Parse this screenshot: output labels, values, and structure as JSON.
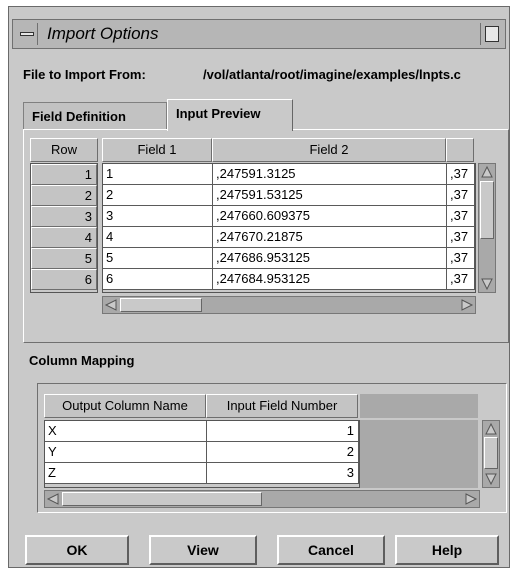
{
  "window": {
    "title": "Import Options"
  },
  "file": {
    "label": "File to Import From:",
    "path": "/vol/atlanta/root/imagine/examples/lnpts.c"
  },
  "tabs": [
    {
      "label": "Field Definition",
      "active": false
    },
    {
      "label": "Input Preview",
      "active": true
    }
  ],
  "preview": {
    "row_header": "Row",
    "columns": [
      "Field 1",
      "Field 2",
      ""
    ],
    "rows": [
      {
        "row": "1",
        "field1": "1",
        "field2": ",247591.3125",
        "field3": ",37"
      },
      {
        "row": "2",
        "field1": "2",
        "field2": ",247591.53125",
        "field3": ",37"
      },
      {
        "row": "3",
        "field1": "3",
        "field2": ",247660.609375",
        "field3": ",37"
      },
      {
        "row": "4",
        "field1": "4",
        "field2": ",247670.21875",
        "field3": ",37"
      },
      {
        "row": "5",
        "field1": "5",
        "field2": ",247686.953125",
        "field3": ",37"
      },
      {
        "row": "6",
        "field1": "6",
        "field2": ",247684.953125",
        "field3": ",37"
      }
    ]
  },
  "mapping": {
    "label": "Column Mapping",
    "columns": [
      "Output Column Name",
      "Input Field Number"
    ],
    "rows": [
      {
        "name": "X",
        "field": "1"
      },
      {
        "name": "Y",
        "field": "2"
      },
      {
        "name": "Z",
        "field": "3"
      }
    ]
  },
  "buttons": {
    "ok": "OK",
    "view": "View",
    "cancel": "Cancel",
    "help": "Help"
  },
  "colors": {
    "background": "#c9c9c9",
    "cell": "#ffffff",
    "trough": "#a9a9a9"
  },
  "icons": [
    "window-menu-icon",
    "maximize-icon",
    "arrow-up-icon",
    "arrow-down-icon",
    "arrow-left-icon",
    "arrow-right-icon"
  ]
}
